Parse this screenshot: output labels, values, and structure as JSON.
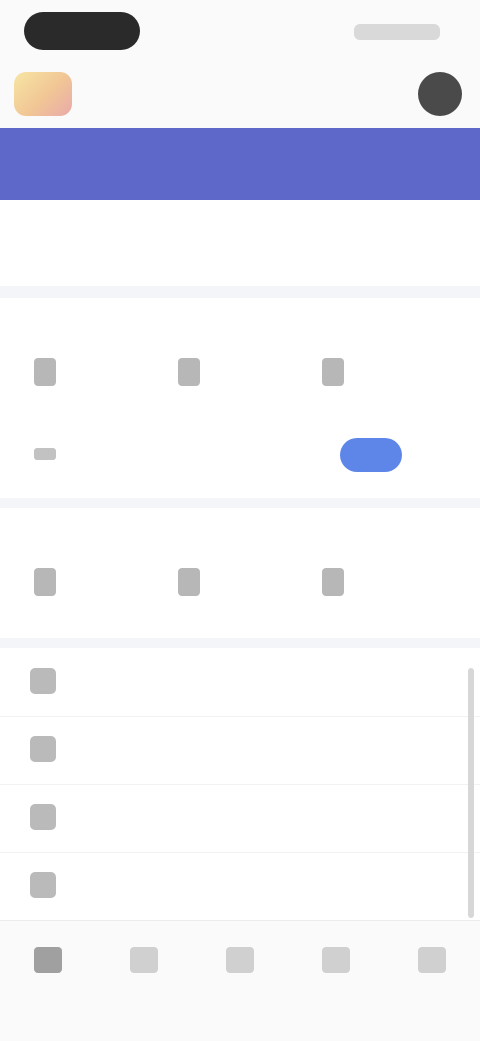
{
  "status_bar": {},
  "header": {
    "title": ""
  },
  "banner": {
    "left_text": "",
    "right_text": ""
  },
  "info_row": {
    "left_text": "",
    "right_text": ""
  },
  "section1": {
    "label": "",
    "items": [
      {
        "label": "",
        "icon": "document-icon"
      },
      {
        "label": "",
        "icon": "stats-icon"
      },
      {
        "label": "",
        "icon": "settings-icon"
      }
    ],
    "toggle": {
      "label": "",
      "on": true
    }
  },
  "section2": {
    "label": "",
    "items": [
      {
        "label": "",
        "icon": "folder-icon"
      },
      {
        "label": "",
        "icon": "chart-icon"
      },
      {
        "label": "",
        "icon": "calendar-icon"
      }
    ]
  },
  "list": [
    {
      "label": "",
      "icon": "info-icon"
    },
    {
      "label": "",
      "icon": "share-icon"
    },
    {
      "label": "",
      "icon": "help-icon"
    },
    {
      "label": "",
      "icon": "contact-icon"
    }
  ],
  "tabs": [
    {
      "label": "",
      "icon": "home-icon",
      "active": true
    },
    {
      "label": "",
      "icon": "discover-icon",
      "active": false
    },
    {
      "label": "",
      "icon": "add-icon",
      "active": false
    },
    {
      "label": "",
      "icon": "message-icon",
      "active": false
    },
    {
      "label": "",
      "icon": "profile-icon",
      "active": false
    }
  ],
  "colors": {
    "banner": "#5d68c9",
    "toggle": "#5e86e8",
    "avatar": "#4a4a4a"
  }
}
